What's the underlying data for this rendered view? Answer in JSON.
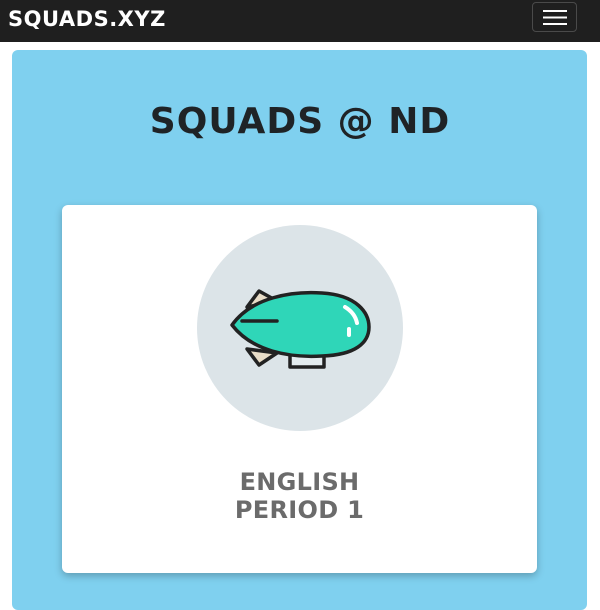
{
  "navbar": {
    "brand": "SQUADS.XYZ",
    "menu_icon": "hamburger-menu-icon"
  },
  "hero": {
    "title": "SQUADS @ ND"
  },
  "squad_card": {
    "icon": "blimp-icon",
    "name_line1": "ENGLISH",
    "name_line2": "PERIOD 1"
  },
  "colors": {
    "navbar_bg": "#1f1f1f",
    "hero_bg": "#7fd0ef",
    "title_text": "#1f2326",
    "card_label": "#6b6b6b",
    "icon_circle": "#dce4e8",
    "blimp_body": "#2fd6b8"
  }
}
